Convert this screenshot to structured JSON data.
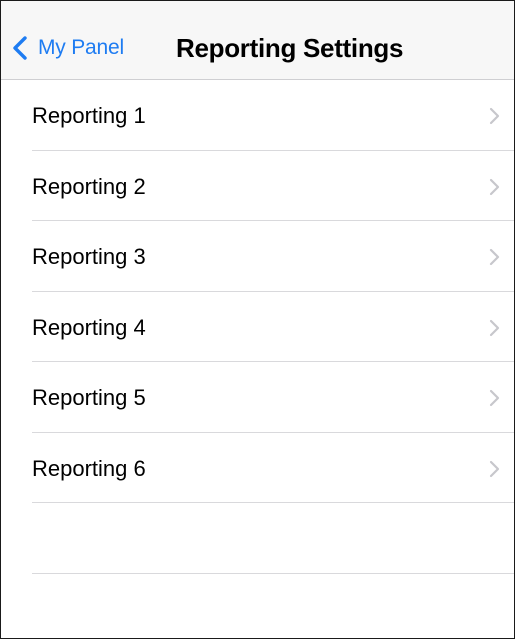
{
  "navbar": {
    "back_label": "My Panel",
    "title": "Reporting Settings"
  },
  "list": {
    "items": [
      {
        "label": "Reporting 1"
      },
      {
        "label": "Reporting 2"
      },
      {
        "label": "Reporting 3"
      },
      {
        "label": "Reporting 4"
      },
      {
        "label": "Reporting 5"
      },
      {
        "label": "Reporting 6"
      }
    ]
  },
  "icons": {
    "back": "chevron-left-icon",
    "disclosure": "chevron-right-icon"
  },
  "colors": {
    "accent": "#1e7cf2",
    "navbar_bg": "#f7f7f7",
    "separator": "#d9d9dc",
    "chevron": "#c7c7cc"
  }
}
